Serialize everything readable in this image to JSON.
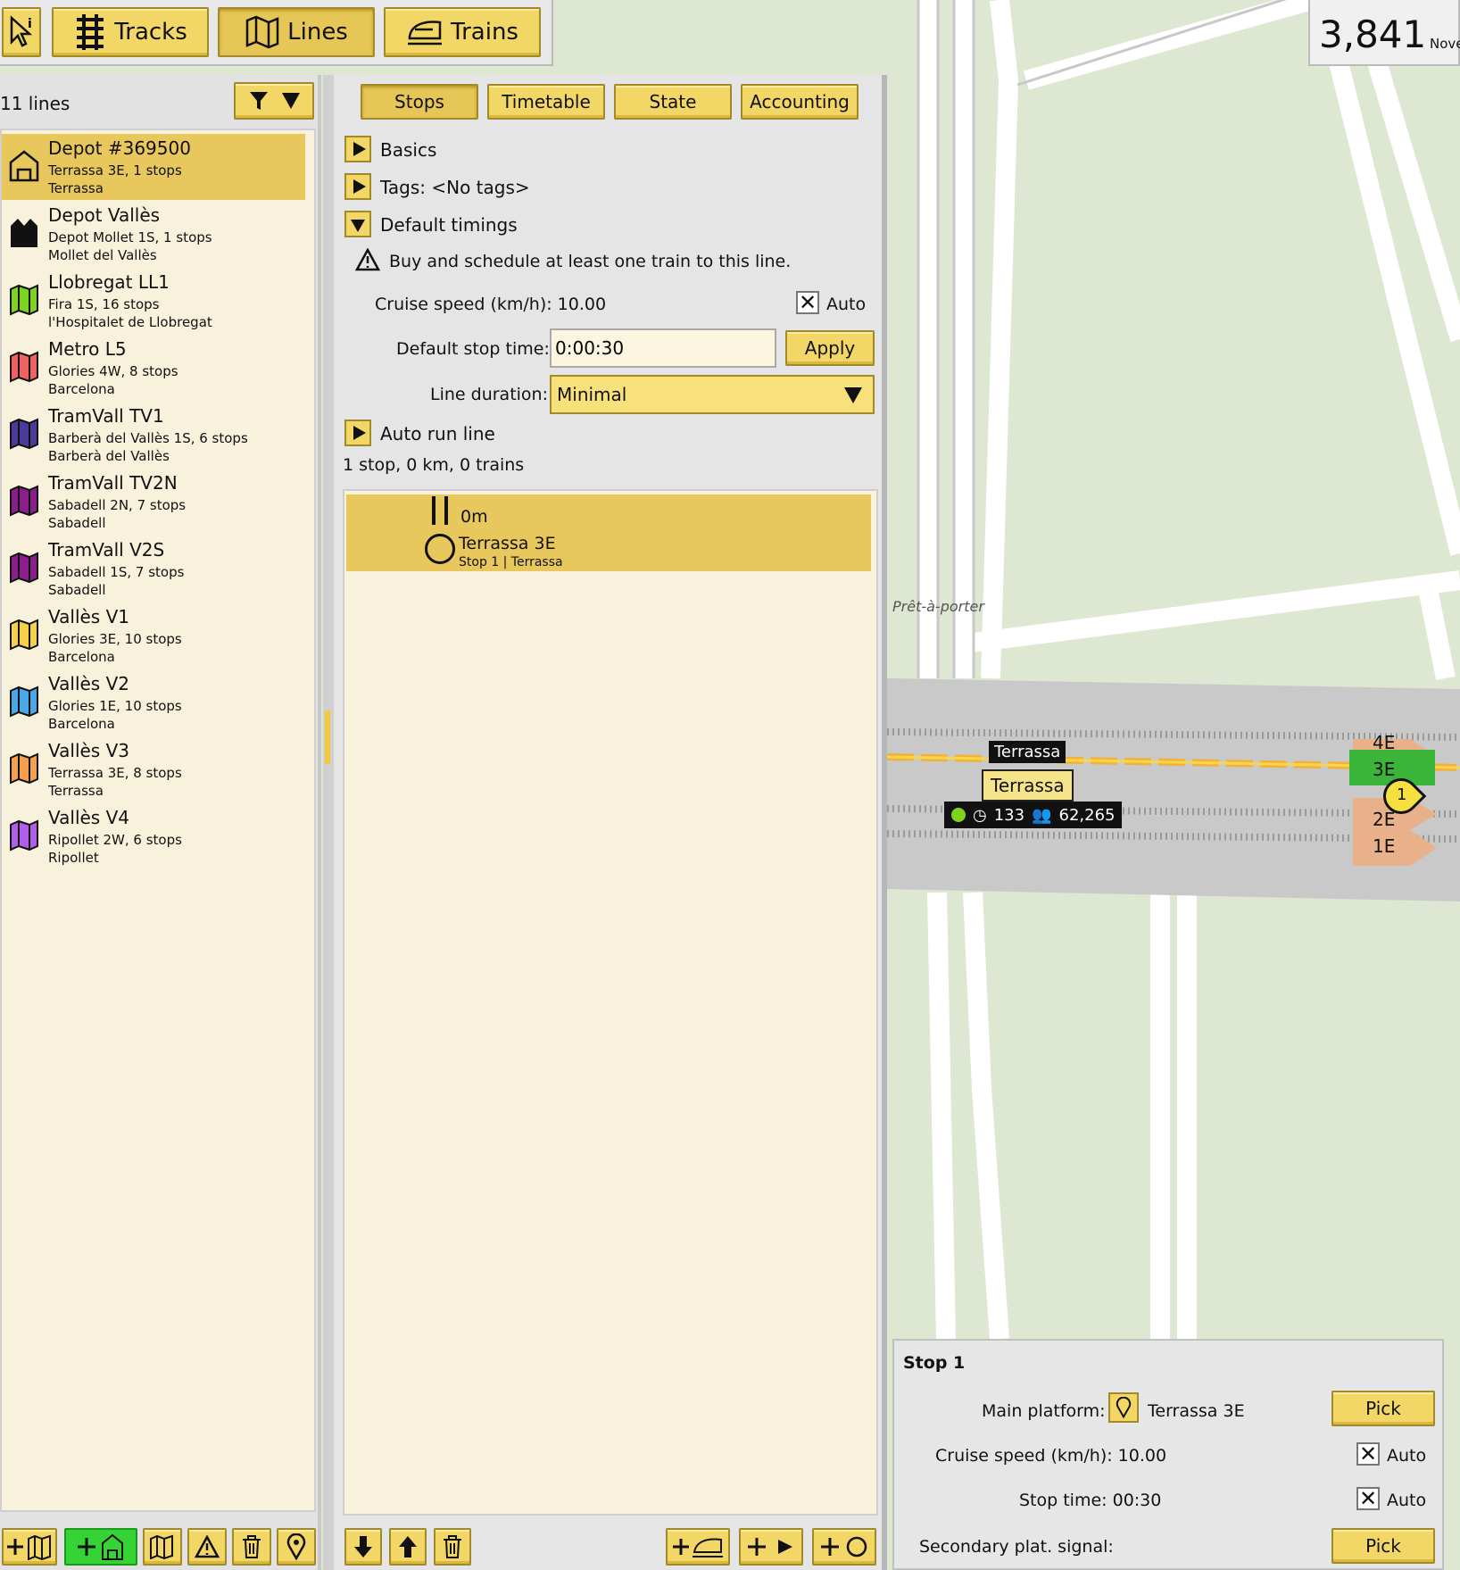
{
  "toolbar": {
    "tracks_label": "Tracks",
    "lines_label": "Lines",
    "trains_label": "Trains"
  },
  "score": {
    "value": "3,841",
    "date_partial": "Nove"
  },
  "left_panel": {
    "lines_count": "11 lines",
    "lines": [
      {
        "name": "Depot #369500",
        "sub1": "Terrassa 3E, 1 stops",
        "sub2": "Terrassa",
        "color": "#e8c85c",
        "icon": "depot-outline-icon"
      },
      {
        "name": "Depot Vallès",
        "sub1": "Depot Mollet 1S, 1 stops",
        "sub2": "Mollet del Vallès",
        "color": "#111111",
        "icon": "depot-icon"
      },
      {
        "name": "Llobregat LL1",
        "sub1": "Fira 1S, 16 stops",
        "sub2": "l'Hospitalet de Llobregat",
        "color": "#7ed321",
        "icon": "line-map-icon"
      },
      {
        "name": "Metro L5",
        "sub1": "Glories 4W, 8 stops",
        "sub2": "Barcelona",
        "color": "#f06262",
        "icon": "line-map-icon"
      },
      {
        "name": "TramVall TV1",
        "sub1": "Barberà del Vallès 1S, 6 stops",
        "sub2": "Barberà del Vallès",
        "color": "#4a3a9a",
        "icon": "line-map-icon"
      },
      {
        "name": "TramVall TV2N",
        "sub1": "Sabadell 2N, 7 stops",
        "sub2": "Sabadell",
        "color": "#8a1e8a",
        "icon": "line-map-icon"
      },
      {
        "name": "TramVall V2S",
        "sub1": "Sabadell 1S, 7 stops",
        "sub2": "Sabadell",
        "color": "#8a1e8a",
        "icon": "line-map-icon"
      },
      {
        "name": "Vallès V1",
        "sub1": "Glories 3E, 10 stops",
        "sub2": "Barcelona",
        "color": "#f5d24a",
        "icon": "line-map-icon"
      },
      {
        "name": "Vallès V2",
        "sub1": "Glories 1E, 10 stops",
        "sub2": "Barcelona",
        "color": "#4aa8e8",
        "icon": "line-map-icon"
      },
      {
        "name": "Vallès V3",
        "sub1": "Terrassa 3E, 8 stops",
        "sub2": "Terrassa",
        "color": "#f5a050",
        "icon": "line-map-icon"
      },
      {
        "name": "Vallès V4",
        "sub1": "Ripollet 2W, 6 stops",
        "sub2": "Ripollet",
        "color": "#b060e8",
        "icon": "line-map-icon"
      }
    ]
  },
  "center_panel": {
    "tabs": [
      "Stops",
      "Timetable",
      "State",
      "Accounting"
    ],
    "basics_label": "Basics",
    "tags_label": "Tags: <No tags>",
    "default_timings_label": "Default timings",
    "warning_text": "Buy and schedule at least one train to this line.",
    "cruise_speed_label": "Cruise speed (km/h): 10.00",
    "auto_label": "Auto",
    "default_stop_time_label": "Default stop time:",
    "default_stop_time_value": "0:00:30",
    "apply_label": "Apply",
    "line_duration_label": "Line duration:",
    "line_duration_value": "Minimal",
    "auto_run_label": "Auto run line",
    "summary": "1 stop, 0 km, 0 trains",
    "stops": [
      {
        "time": "0m",
        "name": "Terrassa 3E",
        "detail": "Stop 1 | Terrassa"
      }
    ]
  },
  "map": {
    "place_label": "Prêt-à-porter",
    "station_name_top": "Terrassa",
    "station_name": "Terrassa",
    "station_stats_a": "133",
    "station_stats_b": "62,265",
    "platforms": [
      "4E",
      "3E",
      "2E",
      "1E"
    ],
    "stop_marker": "1"
  },
  "stop_popup": {
    "title": "Stop 1",
    "main_platform_label": "Main platform:",
    "main_platform_value": "Terrassa 3E",
    "pick_label": "Pick",
    "cruise_speed_label": "Cruise speed (km/h): 10.00",
    "auto_label": "Auto",
    "stop_time_label": "Stop time: 00:30",
    "secondary_label": "Secondary plat. signal:"
  }
}
